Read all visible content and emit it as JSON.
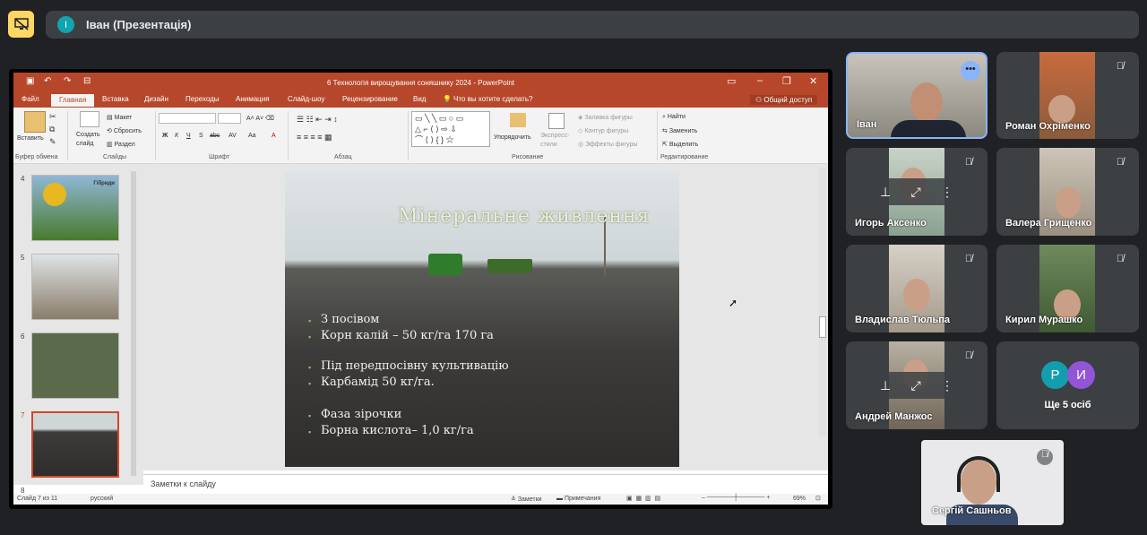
{
  "meeting": {
    "title": "Іван (Презентація)",
    "initial": "І"
  },
  "ppt": {
    "window_title": "6 Технологія вирощування соняшнику 2024 - PowerPoint",
    "tabs": [
      "Файл",
      "Главная",
      "Вставка",
      "Дизайн",
      "Переходы",
      "Анимация",
      "Слайд-шоу",
      "Рецензирование",
      "Вид"
    ],
    "tell_me": "Что вы хотите сделать?",
    "share": "Общий доступ",
    "ribbon": {
      "paste": "Вставить",
      "clipboard": "Буфер обмена",
      "new_slide": "Создать слайд",
      "layout": "Макет",
      "reset": "Сбросить",
      "section": "Раздел",
      "slides": "Слайды",
      "font": "Шрифт",
      "paragraph": "Абзац",
      "arrange": "Упорядочить",
      "quick_styles": "Экспресс-стили",
      "fill": "Заливка фигуры",
      "outline": "Контур фигуры",
      "effects": "Эффекты фигуры",
      "drawing": "Рисование",
      "find": "Найти",
      "replace": "Заменить",
      "select": "Выделить",
      "editing": "Редактирование"
    },
    "font_buttons": [
      "Ж",
      "К",
      "Ч",
      "S",
      "abc",
      "AV",
      "Aa",
      "A"
    ],
    "thumbs": [
      {
        "num": "4",
        "text": "Гібриди"
      },
      {
        "num": "5",
        "text": ""
      },
      {
        "num": "6",
        "text": ""
      },
      {
        "num": "7",
        "text": ""
      },
      {
        "num": "8",
        "text": ""
      }
    ],
    "slide": {
      "title": "Мінеральне живлення",
      "lines": [
        "З посівом",
        "Корн калій – 50 кг/га 170 га",
        "Під передпосівну культивацію",
        "Карбамід 50 кг/га.",
        "Фаза зірочки",
        "Борна кислота– 1,0 кг/га"
      ]
    },
    "notes": "Заметки к слайду",
    "status": {
      "slide": "Слайд 7 из 11",
      "lang": "русский",
      "notes": "Заметки",
      "comments": "Примечания",
      "zoom": "69%"
    }
  },
  "participants": [
    {
      "name": "Іван",
      "active": true
    },
    {
      "name": "Роман Охріменко"
    },
    {
      "name": "Игорь Аксенко"
    },
    {
      "name": "Валера Грищенко"
    },
    {
      "name": "Владислав Тюльпа"
    },
    {
      "name": "Кирил Мурашко"
    },
    {
      "name": "Андрей Манжос"
    },
    {
      "name": "Сергій Сашньов"
    }
  ],
  "more": {
    "label": "Ще 5 осіб",
    "avatars": [
      {
        "letter": "Р",
        "color": "#129eaf"
      },
      {
        "letter": "И",
        "color": "#9155d6"
      }
    ]
  },
  "colors": {
    "accent": "#8ab4f8",
    "ppt_red": "#b7472a",
    "tile": "#3c4043"
  },
  "icons": [
    "present-off-icon",
    "mic-off-icon",
    "more-options-icon",
    "pin-icon"
  ]
}
